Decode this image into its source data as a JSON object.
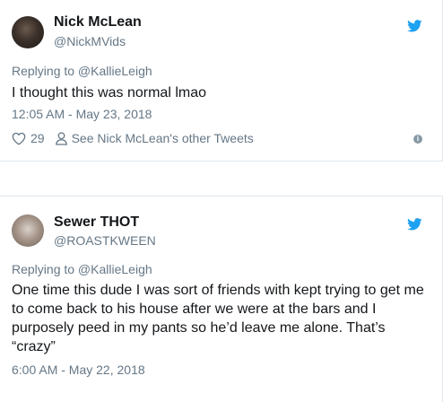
{
  "tweets": [
    {
      "name": "Nick McLean",
      "handle": "@NickMVids",
      "replying_to": "Replying to @KallieLeigh",
      "text": "I thought this was normal lmao",
      "timestamp": "12:05 AM - May 23, 2018",
      "likes": "29",
      "other_tweets": "See Nick McLean's other Tweets",
      "info_icon": "info-icon",
      "bird_icon": "twitter-bird-icon"
    },
    {
      "name": "Sewer THOT",
      "handle": "@ROASTKWEEN",
      "replying_to": "Replying to @KallieLeigh",
      "text": "One time this dude I was sort of friends with kept trying to get me to come back to his house after we were at the bars and I purposely peed in my pants so he’d leave me alone. That’s “crazy”",
      "timestamp": "6:00 AM - May 22, 2018",
      "bird_icon": "twitter-bird-icon"
    }
  ],
  "colors": {
    "twitter_blue": "#1da1f2",
    "secondary_text": "#657786",
    "primary_text": "#14171a",
    "border": "#e1e8ed"
  }
}
